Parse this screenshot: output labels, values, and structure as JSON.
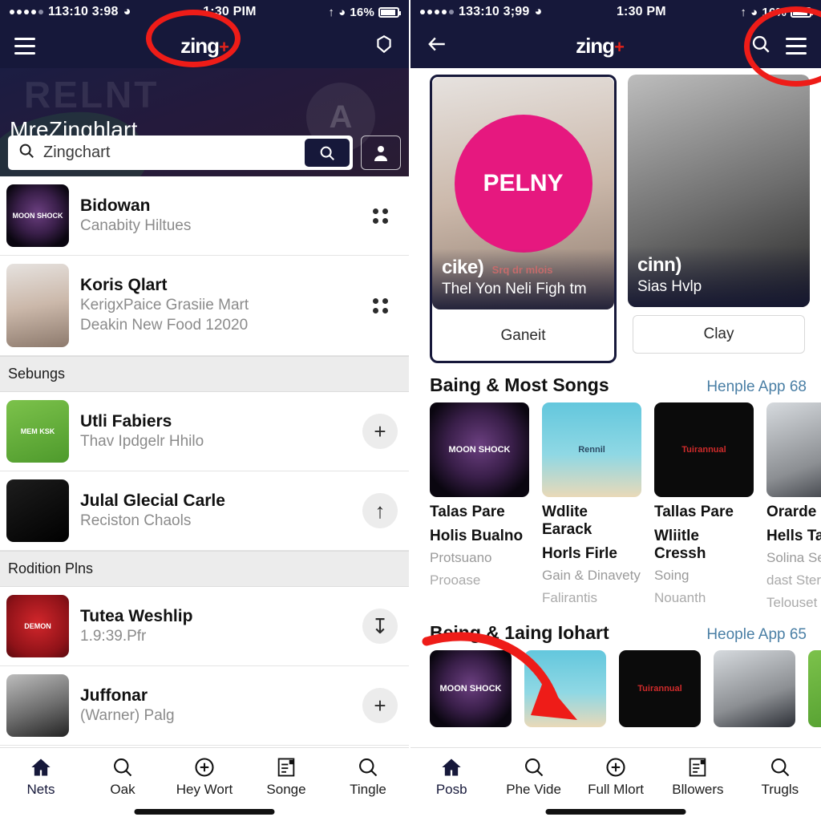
{
  "left": {
    "status": {
      "carrier_dots": 5,
      "time_left": "113:10 3:98",
      "clock": "1:30 PIM",
      "battery": "16%"
    },
    "appbar": {
      "logo": "zing",
      "logo_plus": "+",
      "menu_icon": "hamburger-icon",
      "right_icon": "settings-gear-icon"
    },
    "hero": {
      "ghost_text": "RELNT",
      "ghost_badge": "A",
      "title": "MreZinghlart"
    },
    "search": {
      "value": "Zingchart",
      "placeholder": "Zingchart",
      "go_icon": "search-icon",
      "people_icon": "people-icon"
    },
    "list": [
      {
        "kind": "item",
        "title": "Bidowan",
        "sub": "Canabity Hiltues",
        "art": "art-moon",
        "art_label": "MOON SHOCK",
        "action": "grid-dots-icon"
      },
      {
        "kind": "item",
        "title": "Koris Qlart",
        "sub": "KerigxPaice Grasiie Mart",
        "sub2": "Deakin New Food 12020",
        "art": "art-girl",
        "art_label": "",
        "action": "grid-dots-icon"
      },
      {
        "kind": "header",
        "title": "Sebungs"
      },
      {
        "kind": "item",
        "title": "Utli Fabiers",
        "sub": "Thav Ipdgelr Hhilo",
        "art": "art-green",
        "art_label": "MEM KSK",
        "action": "plus-icon"
      },
      {
        "kind": "item",
        "title": "Julal Glecial Carle",
        "sub": "Reciston Chaols",
        "art": "art-dark",
        "art_label": "",
        "action": "upload-icon"
      },
      {
        "kind": "header",
        "title": "Rodition Plns"
      },
      {
        "kind": "item",
        "title": "Tutea Weshlip",
        "sub": "1.9:39.Pfr",
        "art": "art-red",
        "art_label": "DEMON",
        "action": "download-icon"
      },
      {
        "kind": "item",
        "title": "Juffonar",
        "sub": "(Warner) Palg",
        "art": "art-port",
        "art_label": "",
        "action": "plus-icon"
      }
    ],
    "tabs": [
      {
        "label": "Nets",
        "icon": "home-icon",
        "active": true
      },
      {
        "label": "Oak",
        "icon": "search-icon",
        "active": false
      },
      {
        "label": "Hey Wort",
        "icon": "plus-circle-icon",
        "active": false
      },
      {
        "label": "Songe",
        "icon": "news-icon",
        "active": false
      },
      {
        "label": "Tingle",
        "icon": "search-icon",
        "active": false
      }
    ]
  },
  "right": {
    "status": {
      "carrier_dots": 5,
      "time_left": "133:10 3;99",
      "clock": "1:30 PM",
      "battery": "16%"
    },
    "appbar": {
      "back_icon": "back-arrow-icon",
      "logo": "zing",
      "logo_plus": "+",
      "search_icon": "search-icon",
      "menu_icon": "hamburger-icon"
    },
    "cards": [
      {
        "brand": "cike",
        "brand_mark": ")",
        "kicker": "Srq dr mlois",
        "sub": "Thel Yon Neli Figh tm",
        "cta": "Ganeit",
        "art": "art-girl",
        "art_label": "PELNY",
        "framed": true
      },
      {
        "brand": "cinn",
        "brand_mark": ")",
        "kicker": "",
        "sub": "Sias Hvlp",
        "cta": "Clay",
        "art": "art-port",
        "art_label": "",
        "framed": false
      }
    ],
    "sections": [
      {
        "title": "Baing & Most Songs",
        "link": "Henple App 68",
        "size": "large",
        "items": [
          {
            "t1": "Talas Pare",
            "t2": "Holis Bualno",
            "s": "Protsuano",
            "s2": "Prooase",
            "art": "art-moon",
            "art_label": "MOON SHOCK"
          },
          {
            "t1": "Wdlite Earack",
            "t2": "Horls Firle",
            "s": "Gain & Dinavety",
            "s2": "Falirantis",
            "art": "art-guitar",
            "art_label": "Rennil"
          },
          {
            "t1": "Tallas Pare",
            "t2": "Wliitle Cressh",
            "s": "Soing",
            "s2": "Nouanth",
            "art": "art-black",
            "art_label": "Tuirannual"
          },
          {
            "t1": "Orarde E",
            "t2": "Hells Tai",
            "s": "Solina Selo",
            "s2": "dast Sterad",
            "s3": "Telouset",
            "art": "art-man",
            "art_label": ""
          }
        ]
      },
      {
        "title": "Being & 1aing Iohart",
        "link": "Heople App 65",
        "size": "small",
        "items": [
          {
            "art": "art-moon",
            "art_label": "MOON SHOCK"
          },
          {
            "art": "art-guitar",
            "art_label": ""
          },
          {
            "art": "art-black",
            "art_label": "Tuirannual"
          },
          {
            "art": "art-man",
            "art_label": ""
          },
          {
            "art": "art-green",
            "art_label": ""
          }
        ]
      }
    ],
    "tabs": [
      {
        "label": "Posb",
        "icon": "home-icon",
        "active": true
      },
      {
        "label": "Phe Vide",
        "icon": "search-icon",
        "active": false
      },
      {
        "label": "Full Mlort",
        "icon": "plus-circle-icon",
        "active": false
      },
      {
        "label": "Bllowers",
        "icon": "news-icon",
        "active": false
      },
      {
        "label": "Trugls",
        "icon": "search-icon",
        "active": false
      }
    ]
  },
  "annotations": {
    "left_circle": "red-ellipse-around-logo",
    "right_circle": "red-ellipse-around-search-menu",
    "right_arrow": "red-curved-arrow-to-thumbnail"
  },
  "colors": {
    "brand_navy": "#16183a",
    "accent_red": "#e2231a",
    "annotation_red": "#ee1c18",
    "link_blue": "#4a7fa5",
    "section_grey": "#ececec"
  }
}
